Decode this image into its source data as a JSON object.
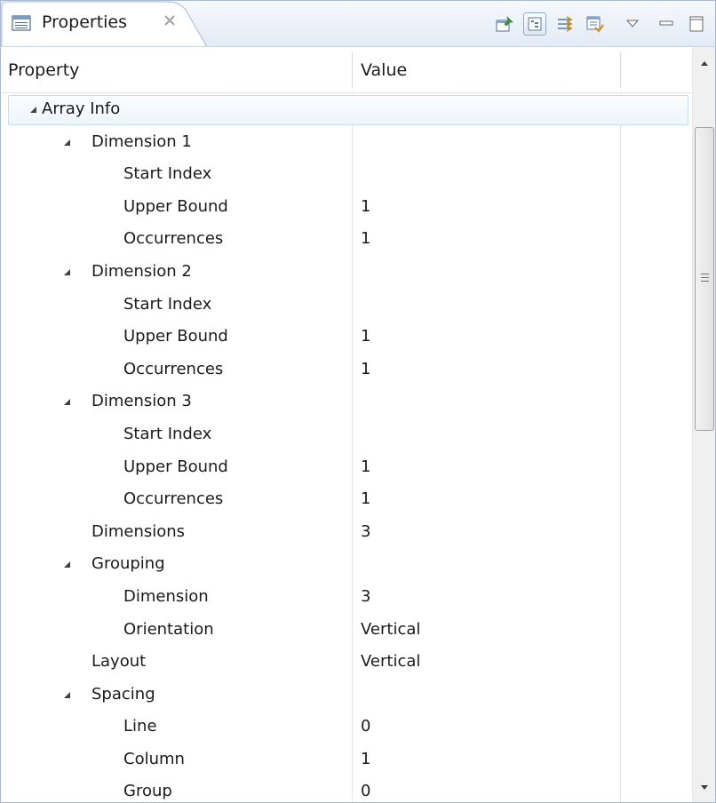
{
  "view": {
    "title": "Properties",
    "close_glyph": "✕",
    "tab_icon": "properties-view-icon"
  },
  "toolbar": {
    "buttons": [
      {
        "name": "pin-to-selection-icon",
        "pressed": false
      },
      {
        "name": "show-categories-icon",
        "pressed": true
      },
      {
        "name": "show-advanced-properties-icon",
        "pressed": false
      },
      {
        "name": "restore-default-value-icon",
        "pressed": false
      }
    ],
    "menu_icon": "view-menu-icon",
    "minimize_icon": "minimize-icon",
    "maximize_icon": "maximize-icon"
  },
  "columns": {
    "property": "Property",
    "value": "Value"
  },
  "rows": [
    {
      "label": "Array Info",
      "value": "",
      "level": 0,
      "expanded": true,
      "selected": true
    },
    {
      "label": "Dimension 1",
      "value": "",
      "level": 1,
      "expanded": true
    },
    {
      "label": "Start Index",
      "value": "",
      "level": 2
    },
    {
      "label": "Upper Bound",
      "value": "1",
      "level": 2
    },
    {
      "label": "Occurrences",
      "value": "1",
      "level": 2
    },
    {
      "label": "Dimension 2",
      "value": "",
      "level": 1,
      "expanded": true
    },
    {
      "label": "Start Index",
      "value": "",
      "level": 2
    },
    {
      "label": "Upper Bound",
      "value": "1",
      "level": 2
    },
    {
      "label": "Occurrences",
      "value": "1",
      "level": 2
    },
    {
      "label": "Dimension 3",
      "value": "",
      "level": 1,
      "expanded": true
    },
    {
      "label": "Start Index",
      "value": "",
      "level": 2
    },
    {
      "label": "Upper Bound",
      "value": "1",
      "level": 2
    },
    {
      "label": "Occurrences",
      "value": "1",
      "level": 2
    },
    {
      "label": "Dimensions",
      "value": "3",
      "level": 1
    },
    {
      "label": "Grouping",
      "value": "",
      "level": 1,
      "expanded": true
    },
    {
      "label": "Dimension",
      "value": "3",
      "level": 2
    },
    {
      "label": "Orientation",
      "value": "Vertical",
      "level": 2
    },
    {
      "label": "Layout",
      "value": "Vertical",
      "level": 1
    },
    {
      "label": "Spacing",
      "value": "",
      "level": 1,
      "expanded": true
    },
    {
      "label": "Line",
      "value": "0",
      "level": 2
    },
    {
      "label": "Column",
      "value": "1",
      "level": 2
    },
    {
      "label": "Group",
      "value": "0",
      "level": 2
    }
  ],
  "colors": {
    "selection_border": "#c5dcf5",
    "frame_border": "#a9b9cf"
  }
}
